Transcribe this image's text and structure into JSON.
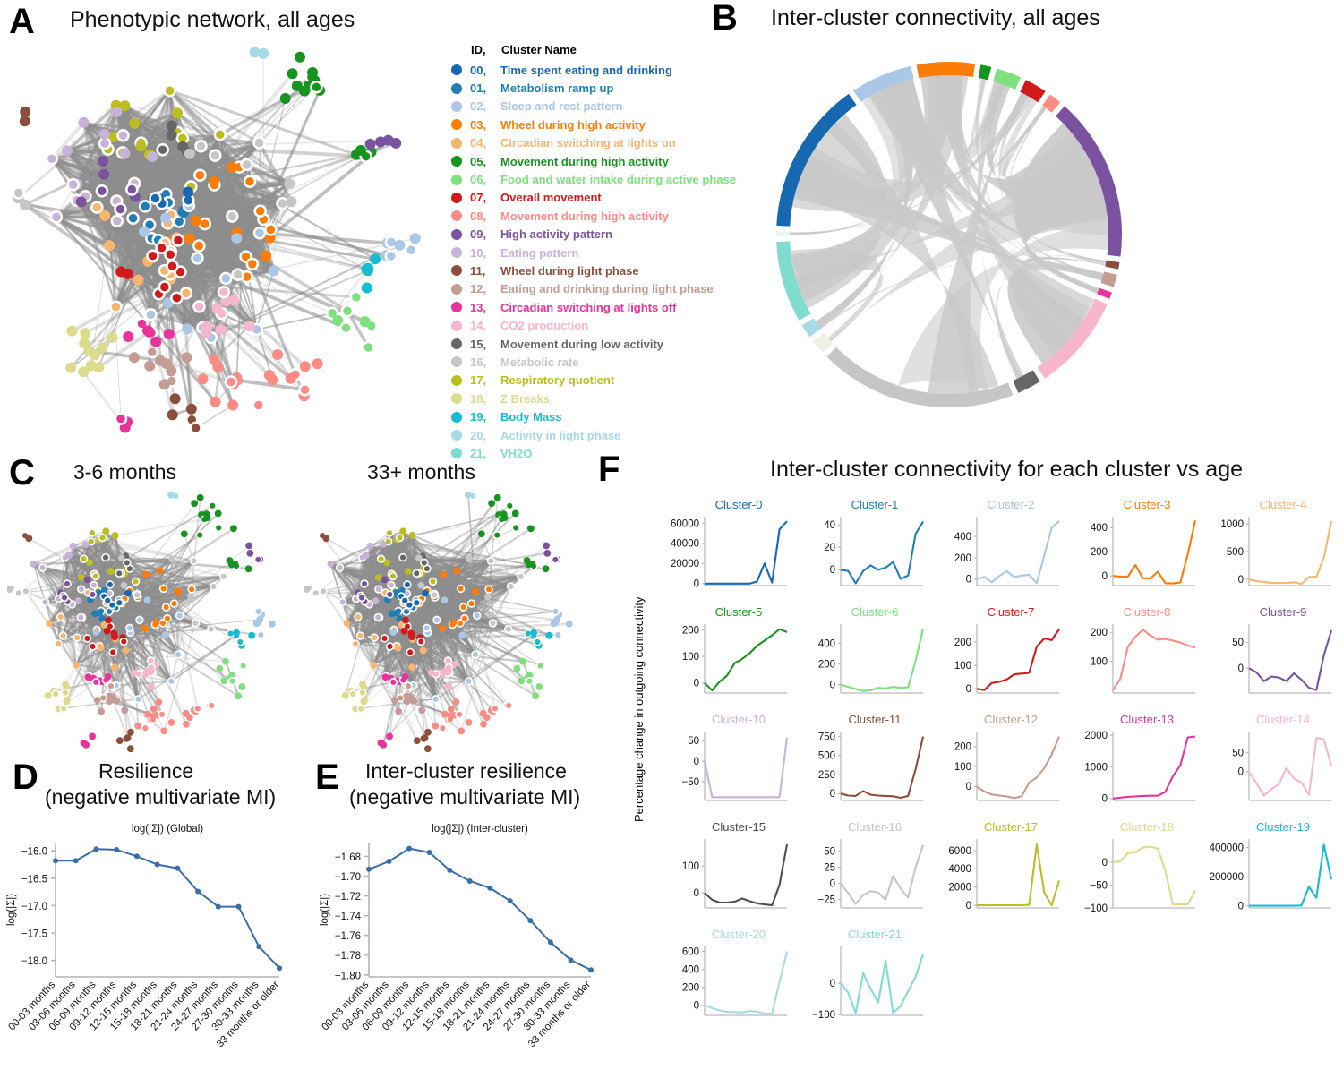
{
  "panels": {
    "A": {
      "letter": "A",
      "title": "Phenotypic network, all ages"
    },
    "B": {
      "letter": "B",
      "title": "Inter-cluster connectivity, all ages"
    },
    "C": {
      "letter": "C",
      "title_left": "3-6 months",
      "title_right": "33+ months"
    },
    "D": {
      "letter": "D",
      "title_line1": "Resilience",
      "title_line2": "(negative multivariate MI)",
      "subtitle": "log(|Σ|) (Global)",
      "ylabel": "log(|Σ|)"
    },
    "E": {
      "letter": "E",
      "title_line1": "Inter-cluster resilience",
      "title_line2": "(negative multivariate MI)",
      "subtitle": "log(|Σ|) (Inter-cluster)",
      "ylabel": "log(|Σ|)"
    },
    "F": {
      "letter": "F",
      "title": "Inter-cluster connectivity for each cluster vs age",
      "ylabel": "Percentage change in outgoing connectivity"
    }
  },
  "legend": {
    "header_id": "ID,",
    "header_name": "Cluster Name",
    "items": [
      {
        "id": "00,",
        "name": "Time spent eating and drinking",
        "color": "#1668b0"
      },
      {
        "id": "01,",
        "name": "Metabolism ramp up",
        "color": "#1f7eb8"
      },
      {
        "id": "02,",
        "name": "Sleep and rest pattern",
        "color": "#aac7e6"
      },
      {
        "id": "03,",
        "name": "Wheel during high activity",
        "color": "#fb7c07"
      },
      {
        "id": "04,",
        "name": "Circadian switching at lights on",
        "color": "#fbb46d"
      },
      {
        "id": "05,",
        "name": "Movement during high activity",
        "color": "#16941f"
      },
      {
        "id": "06,",
        "name": "Food and water intake during active phase",
        "color": "#7ee07f"
      },
      {
        "id": "07,",
        "name": "Overall movement",
        "color": "#d2191c"
      },
      {
        "id": "08,",
        "name": "Movement during high activity",
        "color": "#fb8c85"
      },
      {
        "id": "09,",
        "name": "High activity pattern",
        "color": "#7b52a0"
      },
      {
        "id": "10,",
        "name": "Eating pattern",
        "color": "#c6b3d7"
      },
      {
        "id": "11,",
        "name": "Wheel during light phase",
        "color": "#8b4e3c"
      },
      {
        "id": "12,",
        "name": "Eating and drinking during light phase",
        "color": "#c49c94"
      },
      {
        "id": "13,",
        "name": "Circadian switching at lights off",
        "color": "#e8339c"
      },
      {
        "id": "14,",
        "name": "CO2 production",
        "color": "#f8b6cd"
      },
      {
        "id": "15,",
        "name": "Movement during low activity",
        "color": "#666666"
      },
      {
        "id": "16,",
        "name": "Metabolic rate",
        "color": "#c6c6c6"
      },
      {
        "id": "17,",
        "name": "Respiratory quotient",
        "color": "#bbbd21"
      },
      {
        "id": "18,",
        "name": "Z Breaks",
        "color": "#dbdb8c"
      },
      {
        "id": "19,",
        "name": "Body Mass",
        "color": "#16bdd0"
      },
      {
        "id": "20,",
        "name": "Activity in light phase",
        "color": "#a6dae4"
      },
      {
        "id": "21,",
        "name": "VH2O",
        "color": "#7fddd0"
      }
    ]
  },
  "chord": {
    "segments": [
      {
        "cluster": "00",
        "color": "#1668b0",
        "value": 15.8
      },
      {
        "cluster": "02",
        "color": "#aac7e6",
        "value": 6.4
      },
      {
        "cluster": "03",
        "color": "#fb7c07",
        "value": 6.0
      },
      {
        "cluster": "05",
        "color": "#16941f",
        "value": 1.1
      },
      {
        "cluster": "06",
        "color": "#7ee07f",
        "value": 2.6
      },
      {
        "cluster": "07",
        "color": "#d2191c",
        "value": 2.3
      },
      {
        "cluster": "08",
        "color": "#fb8c85",
        "value": 1.3
      },
      {
        "cluster": "09",
        "color": "#7b52a0",
        "value": 17.0
      },
      {
        "cluster": "11",
        "color": "#8b4e3c",
        "value": 0.7
      },
      {
        "cluster": "12",
        "color": "#c49c94",
        "value": 1.3
      },
      {
        "cluster": "13",
        "color": "#e8339c",
        "value": 0.7
      },
      {
        "cluster": "14",
        "color": "#f8b6cd",
        "value": 10.0
      },
      {
        "cluster": "15",
        "color": "#666666",
        "value": 2.5
      },
      {
        "cluster": "16",
        "color": "#c6c6c6",
        "value": 20.5
      },
      {
        "cluster": "18",
        "color": "#efefe3",
        "value": 1.5
      },
      {
        "cluster": "20",
        "color": "#a6dae4",
        "value": 1.4
      },
      {
        "cluster": "21",
        "color": "#7fddd0",
        "value": 8.4
      },
      {
        "cluster": "other",
        "color": "#e8f4f6",
        "value": 0.5
      }
    ]
  },
  "chart_data": [
    {
      "id": "D",
      "type": "line",
      "title": "log(|Σ|) (Global)",
      "xlabel": "",
      "ylabel": "log(|Σ|)",
      "categories": [
        "00-03 months",
        "03-06 months",
        "06-09 months",
        "09-12 months",
        "12-15 months",
        "15-18 months",
        "18-21 months",
        "21-24 months",
        "24-27 months",
        "27-30 months",
        "30-33 months",
        "33 months or older"
      ],
      "values": [
        -16.18,
        -16.18,
        -15.97,
        -15.98,
        -16.1,
        -16.25,
        -16.32,
        -16.74,
        -17.02,
        -17.02,
        -17.75,
        -18.14
      ],
      "ylim": [
        -18.3,
        -15.85
      ],
      "yticks": [
        -16.0,
        -16.5,
        -17.0,
        -17.5,
        -18.0
      ],
      "ytick_labels": [
        "−16.0",
        "−16.5",
        "−17.0",
        "−17.5",
        "−18.0"
      ],
      "color": "#3a6ea8",
      "grid": false,
      "markers": true
    },
    {
      "id": "E",
      "type": "line",
      "title": "log(|Σ|) (Inter-cluster)",
      "xlabel": "",
      "ylabel": "log(|Σ|)",
      "categories": [
        "00-03 months",
        "03-06 months",
        "06-09 months",
        "09-12 months",
        "12-15 months",
        "15-18 months",
        "18-21 months",
        "21-24 months",
        "24-27 months",
        "27-30 months",
        "30-33 months",
        "33 months or older"
      ],
      "values": [
        -1.693,
        -1.685,
        -1.672,
        -1.676,
        -1.694,
        -1.705,
        -1.712,
        -1.725,
        -1.745,
        -1.767,
        -1.785,
        -1.795
      ],
      "ylim": [
        -1.802,
        -1.666
      ],
      "yticks": [
        -1.68,
        -1.7,
        -1.72,
        -1.74,
        -1.76,
        -1.78,
        -1.8
      ],
      "ytick_labels": [
        "−1.68",
        "−1.70",
        "−1.72",
        "−1.74",
        "−1.76",
        "−1.78",
        "−1.80"
      ],
      "color": "#3a6ea8",
      "grid": false,
      "markers": true
    },
    {
      "id": "F",
      "type": "line",
      "title": "Inter-cluster connectivity for each cluster vs age",
      "ylabel": "Percentage change in outgoing connectivity",
      "subplots": [
        {
          "label": "Cluster-0",
          "color": "#1668b0",
          "values": [
            0,
            0,
            0,
            0,
            0,
            0,
            0,
            2000,
            20000,
            1000,
            54000,
            62000
          ],
          "ylim": [
            -2000,
            64000
          ],
          "yticks": [
            0,
            20000,
            40000,
            60000
          ],
          "ytick_labels": [
            "0",
            "20000",
            "40000",
            "60000"
          ]
        },
        {
          "label": "Cluster-1",
          "color": "#1f7eb8",
          "values": [
            0,
            -1,
            -12,
            -1,
            4,
            0,
            2,
            7,
            -8,
            -5,
            32,
            43
          ],
          "ylim": [
            -14,
            45
          ],
          "yticks": [
            0,
            20,
            40
          ],
          "ytick_labels": [
            "0",
            "20",
            "40"
          ]
        },
        {
          "label": "Cluster-2",
          "color": "#aac7e6",
          "values": [
            0,
            22,
            -30,
            30,
            75,
            20,
            35,
            40,
            -38,
            220,
            480,
            545
          ],
          "ylim": [
            -60,
            560
          ],
          "yticks": [
            0,
            200,
            400
          ],
          "ytick_labels": [
            "0",
            "200",
            "400"
          ]
        },
        {
          "label": "Cluster-3",
          "color": "#fb7c07",
          "values": [
            0,
            -5,
            -5,
            90,
            -18,
            -20,
            35,
            -60,
            -62,
            -55,
            180,
            460
          ],
          "ylim": [
            -80,
            470
          ],
          "yticks": [
            0,
            200,
            400
          ],
          "ytick_labels": [
            "0",
            "200",
            "400"
          ]
        },
        {
          "label": "Cluster-4",
          "color": "#fbb46d",
          "values": [
            0,
            -30,
            -45,
            -60,
            -65,
            -62,
            -52,
            -80,
            45,
            50,
            390,
            1050
          ],
          "ylim": [
            -110,
            1080
          ],
          "yticks": [
            0,
            500,
            1000
          ],
          "ytick_labels": [
            "0",
            "500",
            "1000"
          ]
        },
        {
          "label": "Cluster-5",
          "color": "#16941f",
          "values": [
            0,
            -28,
            5,
            28,
            75,
            90,
            112,
            140,
            160,
            180,
            203,
            192
          ],
          "ylim": [
            -38,
            212
          ],
          "yticks": [
            0,
            100,
            200
          ],
          "ytick_labels": [
            "0",
            "100",
            "200"
          ]
        },
        {
          "label": "Cluster-6",
          "color": "#7ee07f",
          "values": [
            0,
            -20,
            -40,
            -60,
            -52,
            -30,
            -35,
            -20,
            -30,
            -25,
            230,
            540
          ],
          "ylim": [
            -80,
            560
          ],
          "yticks": [
            0,
            200,
            400
          ],
          "ytick_labels": [
            "0",
            "200",
            "400"
          ]
        },
        {
          "label": "Cluster-7",
          "color": "#d2191c",
          "values": [
            0,
            -5,
            25,
            30,
            40,
            62,
            65,
            68,
            180,
            215,
            208,
            255
          ],
          "ylim": [
            -18,
            265
          ],
          "yticks": [
            0,
            100,
            200
          ],
          "ytick_labels": [
            "0",
            "100",
            "200"
          ]
        },
        {
          "label": "Cluster-8",
          "color": "#fb8c85",
          "values": [
            0,
            40,
            150,
            185,
            210,
            190,
            175,
            178,
            172,
            165,
            155,
            148
          ],
          "ylim": [
            -10,
            220
          ],
          "yticks": [
            100,
            200
          ],
          "ytick_labels": [
            "100",
            "200"
          ]
        },
        {
          "label": "Cluster-9",
          "color": "#7b52a0",
          "values": [
            0,
            -8,
            -25,
            -16,
            -18,
            -25,
            -10,
            -22,
            -38,
            -42,
            25,
            73
          ],
          "ylim": [
            -48,
            80
          ],
          "yticks": [
            0,
            50
          ],
          "ytick_labels": [
            "0",
            "50"
          ]
        },
        {
          "label": "Cluster-10",
          "color": "#c6b3d7",
          "values": [
            0,
            -88,
            -88,
            -88,
            -88,
            -88,
            -88,
            -88,
            -88,
            -88,
            -88,
            58
          ],
          "ylim": [
            -96,
            66
          ],
          "yticks": [
            -50,
            0,
            50
          ],
          "ytick_labels": [
            "−50",
            "0",
            "50"
          ]
        },
        {
          "label": "Cluster-11",
          "color": "#8b4e3c",
          "values": [
            0,
            -25,
            -30,
            35,
            -15,
            -25,
            -30,
            -35,
            -55,
            -30,
            320,
            750
          ],
          "ylim": [
            -90,
            780
          ],
          "yticks": [
            0,
            250,
            500,
            750
          ],
          "ytick_labels": [
            "0",
            "250",
            "500",
            "750"
          ]
        },
        {
          "label": "Cluster-12",
          "color": "#c49c94",
          "values": [
            0,
            -25,
            -40,
            -45,
            -50,
            -58,
            -48,
            20,
            45,
            92,
            160,
            250
          ],
          "ylim": [
            -70,
            262
          ],
          "yticks": [
            0,
            100,
            200
          ],
          "ytick_labels": [
            "0",
            "100",
            "200"
          ]
        },
        {
          "label": "Cluster-13",
          "color": "#e8339c",
          "values": [
            0,
            30,
            55,
            70,
            85,
            90,
            90,
            210,
            700,
            1050,
            1930,
            1960
          ],
          "ylim": [
            -60,
            2030
          ],
          "yticks": [
            0,
            1000,
            2000
          ],
          "ytick_labels": [
            "0",
            "1000",
            "2000"
          ]
        },
        {
          "label": "Cluster-14",
          "color": "#f8b6cd",
          "values": [
            0,
            -30,
            -62,
            -45,
            -32,
            10,
            -18,
            -28,
            -60,
            88,
            85,
            15
          ],
          "ylim": [
            -75,
            98
          ],
          "yticks": [
            0,
            50
          ],
          "ytick_labels": [
            "0",
            "50"
          ]
        },
        {
          "label": "Cluster-15",
          "color": "#4d4d4d",
          "values": [
            0,
            -25,
            -35,
            -35,
            -32,
            -20,
            -30,
            -38,
            -42,
            -45,
            30,
            180
          ],
          "ylim": [
            -55,
            190
          ],
          "yticks": [
            0,
            100
          ],
          "ytick_labels": [
            "0",
            "100"
          ]
        },
        {
          "label": "Cluster-16",
          "color": "#c6c6c6",
          "values": [
            0,
            -15,
            -32,
            -18,
            -12,
            -14,
            -25,
            12,
            -8,
            -22,
            25,
            60
          ],
          "ylim": [
            -38,
            65
          ],
          "yticks": [
            -25,
            0,
            25,
            50
          ],
          "ytick_labels": [
            "−25",
            "0",
            "25",
            "50"
          ]
        },
        {
          "label": "Cluster-17",
          "color": "#bbbd21",
          "values": [
            0,
            0,
            0,
            0,
            0,
            0,
            0,
            50,
            6700,
            1400,
            0,
            2700
          ],
          "ylim": [
            -300,
            7000
          ],
          "yticks": [
            0,
            2000,
            4000,
            6000
          ],
          "ytick_labels": [
            "0",
            "2000",
            "4000",
            "6000"
          ]
        },
        {
          "label": "Cluster-18",
          "color": "#dbdb8c",
          "values": [
            0,
            2,
            20,
            22,
            32,
            34,
            30,
            -18,
            -92,
            -92,
            -92,
            -62
          ],
          "ylim": [
            -100,
            45
          ],
          "yticks": [
            -100,
            -50,
            0
          ],
          "ytick_labels": [
            "−100",
            "−50",
            "0"
          ]
        },
        {
          "label": "Cluster-19",
          "color": "#16bdd0",
          "values": [
            0,
            0,
            0,
            0,
            0,
            0,
            0,
            1500,
            130000,
            55000,
            420000,
            180000
          ],
          "ylim": [
            -15000,
            440000
          ],
          "yticks": [
            0,
            200000,
            400000
          ],
          "ytick_labels": [
            "0",
            "200000",
            "400000"
          ]
        },
        {
          "label": "Cluster-20",
          "color": "#a6dae4",
          "values": [
            0,
            -30,
            -55,
            -70,
            -72,
            -78,
            -62,
            -68,
            -88,
            -90,
            260,
            600
          ],
          "ylim": [
            -110,
            625
          ],
          "yticks": [
            0,
            200,
            400,
            600
          ],
          "ytick_labels": [
            "0",
            "200",
            "400",
            "600"
          ]
        },
        {
          "label": "Cluster-21",
          "color": "#7fddd0",
          "values": [
            0,
            -30,
            -95,
            32,
            -18,
            -62,
            72,
            -95,
            -72,
            -25,
            20,
            92
          ],
          "ylim": [
            -102,
            108
          ],
          "yticks": [
            -100,
            0
          ],
          "ytick_labels": [
            "−100",
            "0"
          ]
        }
      ]
    }
  ]
}
